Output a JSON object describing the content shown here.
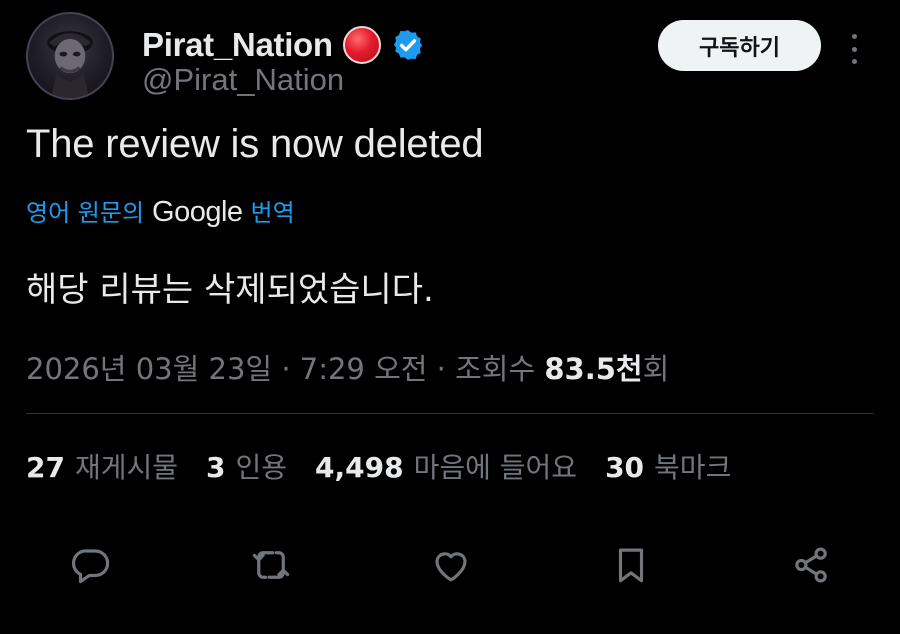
{
  "author": {
    "display_name": "Pirat_Nation",
    "handle": "@Pirat_Nation",
    "badge_icon": "red-circle-icon",
    "verified_icon": "verified-badge-icon",
    "verified_color": "#1d9bf0"
  },
  "header": {
    "subscribe_label": "구독하기",
    "more_icon": "more-vertical-icon"
  },
  "tweet": {
    "text": "The review is now deleted",
    "translation_prefix": "영어 원문의",
    "translation_brand": "Google",
    "translation_suffix": "번역",
    "translated_text": "해당 리뷰는 삭제되었습니다."
  },
  "meta": {
    "date": "2026년 03월 23일",
    "sep1": "·",
    "time": "7:29 오전",
    "sep2": "·",
    "views_label": "조회수",
    "views_value": "83.5천",
    "views_suffix": "회"
  },
  "stats": [
    {
      "value": "27",
      "label": "재게시물"
    },
    {
      "value": "3",
      "label": "인용"
    },
    {
      "value": "4,498",
      "label": "마음에 들어요"
    },
    {
      "value": "30",
      "label": "북마크"
    }
  ],
  "actions": [
    "reply-icon",
    "repost-icon",
    "like-icon",
    "bookmark-icon",
    "share-icon"
  ],
  "colors": {
    "background": "#000000",
    "text_primary": "#e7e9ea",
    "text_secondary": "#71767b",
    "accent": "#1d9bf0",
    "divider": "#2f3336"
  }
}
